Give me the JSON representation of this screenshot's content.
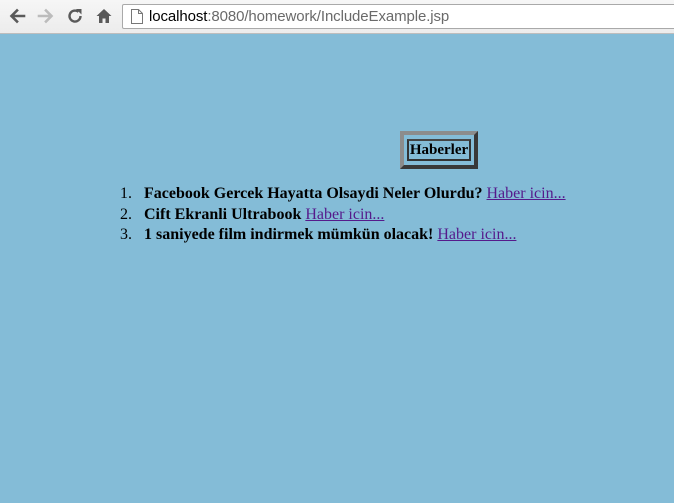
{
  "browser": {
    "url_host": "localhost",
    "url_rest": ":8080/homework/IncludeExample.jsp",
    "icons": {
      "back": "back-arrow-icon",
      "forward": "forward-arrow-icon",
      "reload": "reload-icon",
      "home": "home-icon",
      "page": "page-icon"
    }
  },
  "page": {
    "background": "#84bcd7",
    "heading": "Haberler",
    "news": [
      {
        "num": "1.",
        "title": "Facebook Gercek Hayatta Olsaydi Neler Olurdu?",
        "link": "Haber icin..."
      },
      {
        "num": "2.",
        "title": "Cift Ekranli Ultrabook",
        "link": "Haber icin..."
      },
      {
        "num": "3.",
        "title": "1 saniyede film indirmek mümkün olacak!",
        "link": "Haber icin..."
      }
    ],
    "link_color": "#551a8b"
  }
}
